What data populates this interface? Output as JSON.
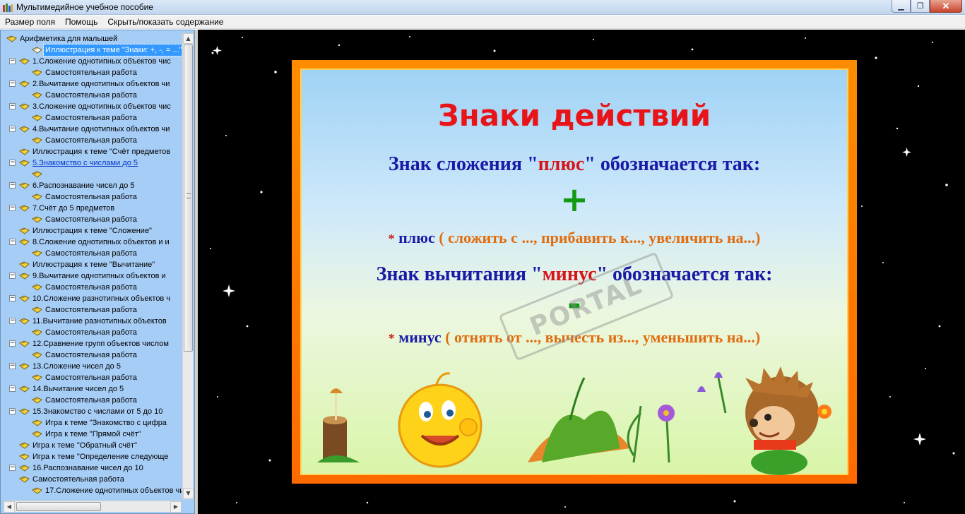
{
  "window": {
    "title": "Мультимедийное учебное пособие",
    "buttons": {
      "minimize": "▁",
      "maximize": "❐",
      "close": "✕"
    }
  },
  "menu": [
    "Размер поля",
    "Помощь",
    "Скрыть/показать содержание"
  ],
  "tree": {
    "root": "Арифметика для малышей",
    "items": [
      "Иллюстрация к теме \"Знаки: +, -, = ...\"",
      "1.Сложение однотипных объектов чис",
      "Самостоятельная работа",
      "2.Вычитание однотипных объектов чи",
      "Самостоятельная работа",
      "3.Сложение однотипных объектов чис",
      "Самостоятельная работа",
      "4.Вычитание однотипных объектов чи",
      "Самостоятельная работа",
      "Иллюстрация к теме \"Счёт предметов",
      "5.Знакомство с числами до 5",
      "",
      "6.Распознавание чисел до 5",
      "Самостоятельная работа",
      "7.Счёт до 5 предметов",
      "Самостоятельная работа",
      "Иллюстрация к теме \"Сложение\"",
      "8.Сложение однотипных объектов и и",
      "Самостоятельная работа",
      "Иллюстрация к теме \"Вычитание\"",
      "9.Вычитание однотипных объектов и",
      "Самостоятельная работа",
      "10.Сложение разнотипных объектов ч",
      "Самостоятельная работа",
      "11.Вычитание разнотипных объектов",
      "Самостоятельная работа",
      "12.Сравнение групп объектов числом",
      "Самостоятельная работа",
      "13.Сложение чисел до 5",
      "Самостоятельная работа",
      "14.Вычитание чисел до 5",
      "Самостоятельная работа",
      "15.Знакомство с числами от 5 до 10",
      "Игра к теме \"Знакомство с цифра",
      "Игра к теме \"Прямой счёт\"",
      "Игра к теме \"Обратный счёт\"",
      "Игра к теме \"Определение следующе",
      "16.Распознавание чисел до 10",
      "Самостоятельная работа",
      "17.Сложение однотипных объектов чи"
    ]
  },
  "slide": {
    "title": "Знаки действий",
    "plus_line": {
      "pre": "Знак сложения \"",
      "word": "плюс",
      "post": "\" обозначается так:"
    },
    "plus_sign": "+",
    "plus_desc": {
      "star": "*",
      "word": "плюс",
      "text": " ( сложить с ..., прибавить к..., увеличить на...)"
    },
    "minus_line": {
      "pre": "Знак вычитания \"",
      "word": "минус",
      "post": "\" обозначается так:"
    },
    "minus_sign": "-",
    "minus_desc": {
      "star": "*",
      "word": "минус",
      "text": " ( отнять от ..., вычесть из..., уменьшить на...)"
    },
    "watermark": "PORTAL"
  },
  "colors": {
    "title_red": "#e8141a",
    "text_blue": "#1a1aa8",
    "orange": "#e06d10",
    "sign_green": "#129a12",
    "frame": "#ff7a00"
  }
}
